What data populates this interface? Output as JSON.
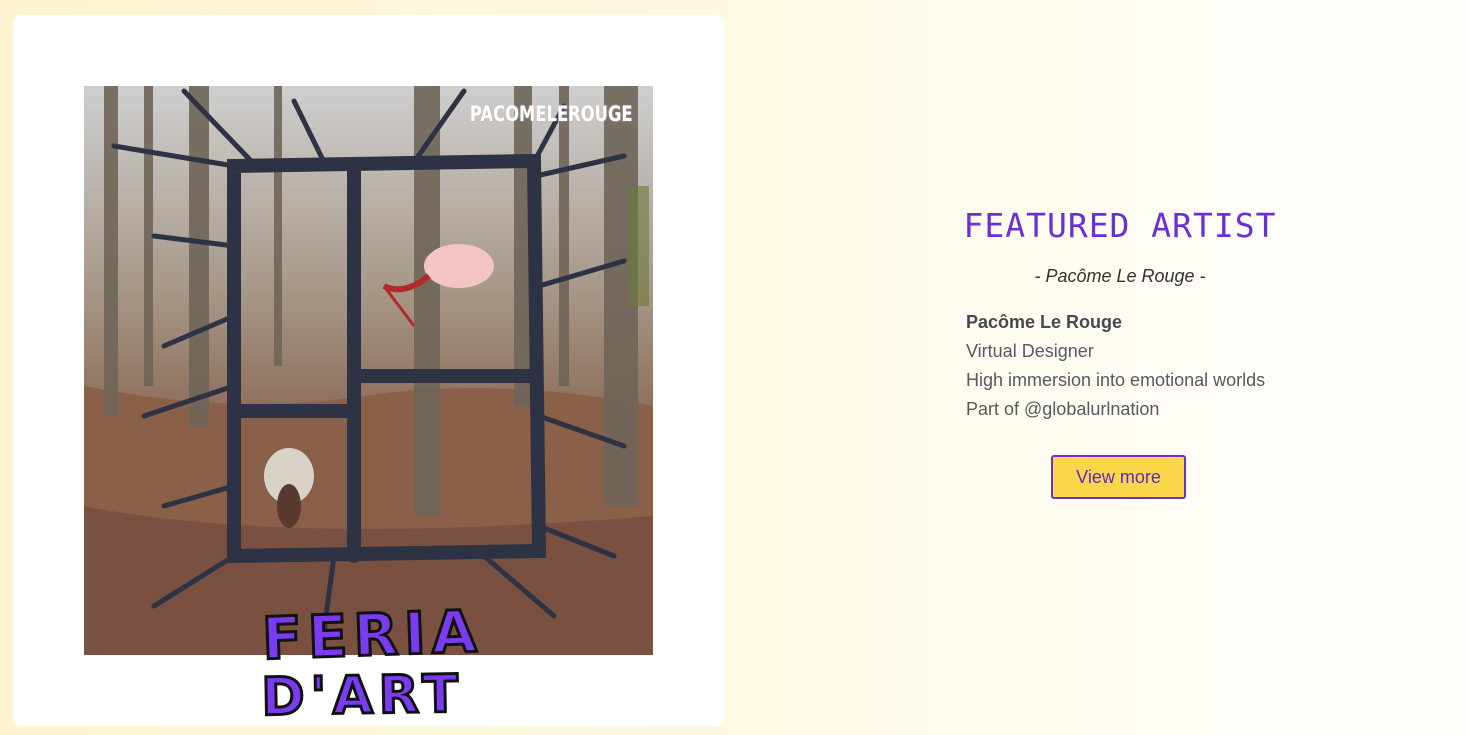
{
  "featured": {
    "heading": "FEATURED ARTIST",
    "subtitle": "- Pacôme Le Rouge -",
    "name": "Pacôme Le Rouge",
    "lines": [
      "Virtual Designer",
      "High immersion into emotional worlds",
      "Part of @globalurlnation"
    ],
    "button_label": "View more"
  },
  "artwork": {
    "watermark": "PACOMELEROUGE",
    "logo_line1": "FERIA",
    "logo_line2": "D'ART"
  },
  "colors": {
    "accent_purple": "#6a2fd6",
    "button_yellow": "#fcd64a",
    "logo_purple": "#7a3cf0"
  }
}
